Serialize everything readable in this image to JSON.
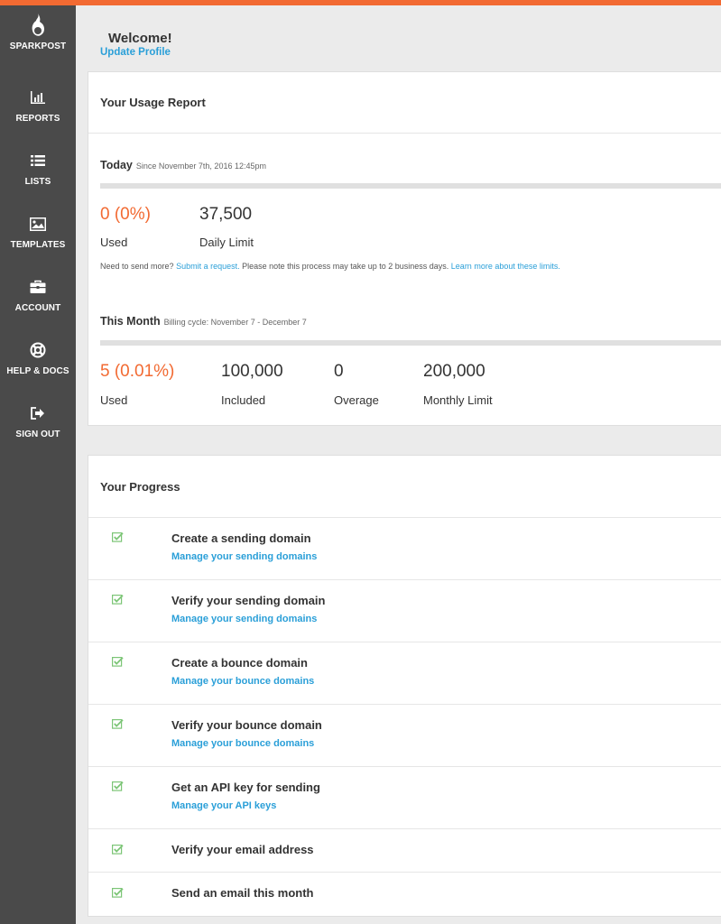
{
  "app": {
    "name": "SPARKPOST"
  },
  "sidebar": {
    "items": [
      {
        "label": "REPORTS",
        "icon": "bar-chart-icon"
      },
      {
        "label": "LISTS",
        "icon": "list-icon"
      },
      {
        "label": "TEMPLATES",
        "icon": "image-icon"
      },
      {
        "label": "ACCOUNT",
        "icon": "briefcase-icon"
      },
      {
        "label": "HELP & DOCS",
        "icon": "lifebuoy-icon"
      },
      {
        "label": "SIGN OUT",
        "icon": "sign-out-icon"
      }
    ]
  },
  "header": {
    "welcome": "Welcome!",
    "update_profile": "Update Profile"
  },
  "usage": {
    "title": "Your Usage Report",
    "today": {
      "heading": "Today",
      "since": "Since November 7th, 2016 12:45pm",
      "used_value": "0 (0%)",
      "used_label": "Used",
      "limit_value": "37,500",
      "limit_label": "Daily Limit",
      "usage_fraction": 0,
      "note_prefix": "Need to send more?",
      "note_link1": "Submit a request.",
      "note_middle": "Please note this process may take up to 2 business days.",
      "note_link2": "Learn more about these limits."
    },
    "month": {
      "heading": "This Month",
      "cycle": "Billing cycle: November 7 - December 7",
      "usage_fraction": 5e-05,
      "stats": [
        {
          "value": "5 (0.01%)",
          "label": "Used",
          "accent": true
        },
        {
          "value": "100,000",
          "label": "Included",
          "accent": false
        },
        {
          "value": "0",
          "label": "Overage",
          "accent": false
        },
        {
          "value": "200,000",
          "label": "Monthly Limit",
          "accent": false
        }
      ]
    }
  },
  "progress": {
    "title": "Your Progress",
    "steps": [
      {
        "title": "Create a sending domain",
        "link": "Manage your sending domains",
        "done": true
      },
      {
        "title": "Verify your sending domain",
        "link": "Manage your sending domains",
        "done": true
      },
      {
        "title": "Create a bounce domain",
        "link": "Manage your bounce domains",
        "done": true
      },
      {
        "title": "Verify your bounce domain",
        "link": "Manage your bounce domains",
        "done": true
      },
      {
        "title": "Get an API key for sending",
        "link": "Manage your API keys",
        "done": true
      },
      {
        "title": "Verify your email address",
        "link": "",
        "done": true
      },
      {
        "title": "Send an email this month",
        "link": "",
        "done": true
      }
    ]
  },
  "colors": {
    "accent": "#f26a32",
    "link": "#2a9fd8",
    "sidebar": "#4a4a4a",
    "check": "#7cc576"
  }
}
